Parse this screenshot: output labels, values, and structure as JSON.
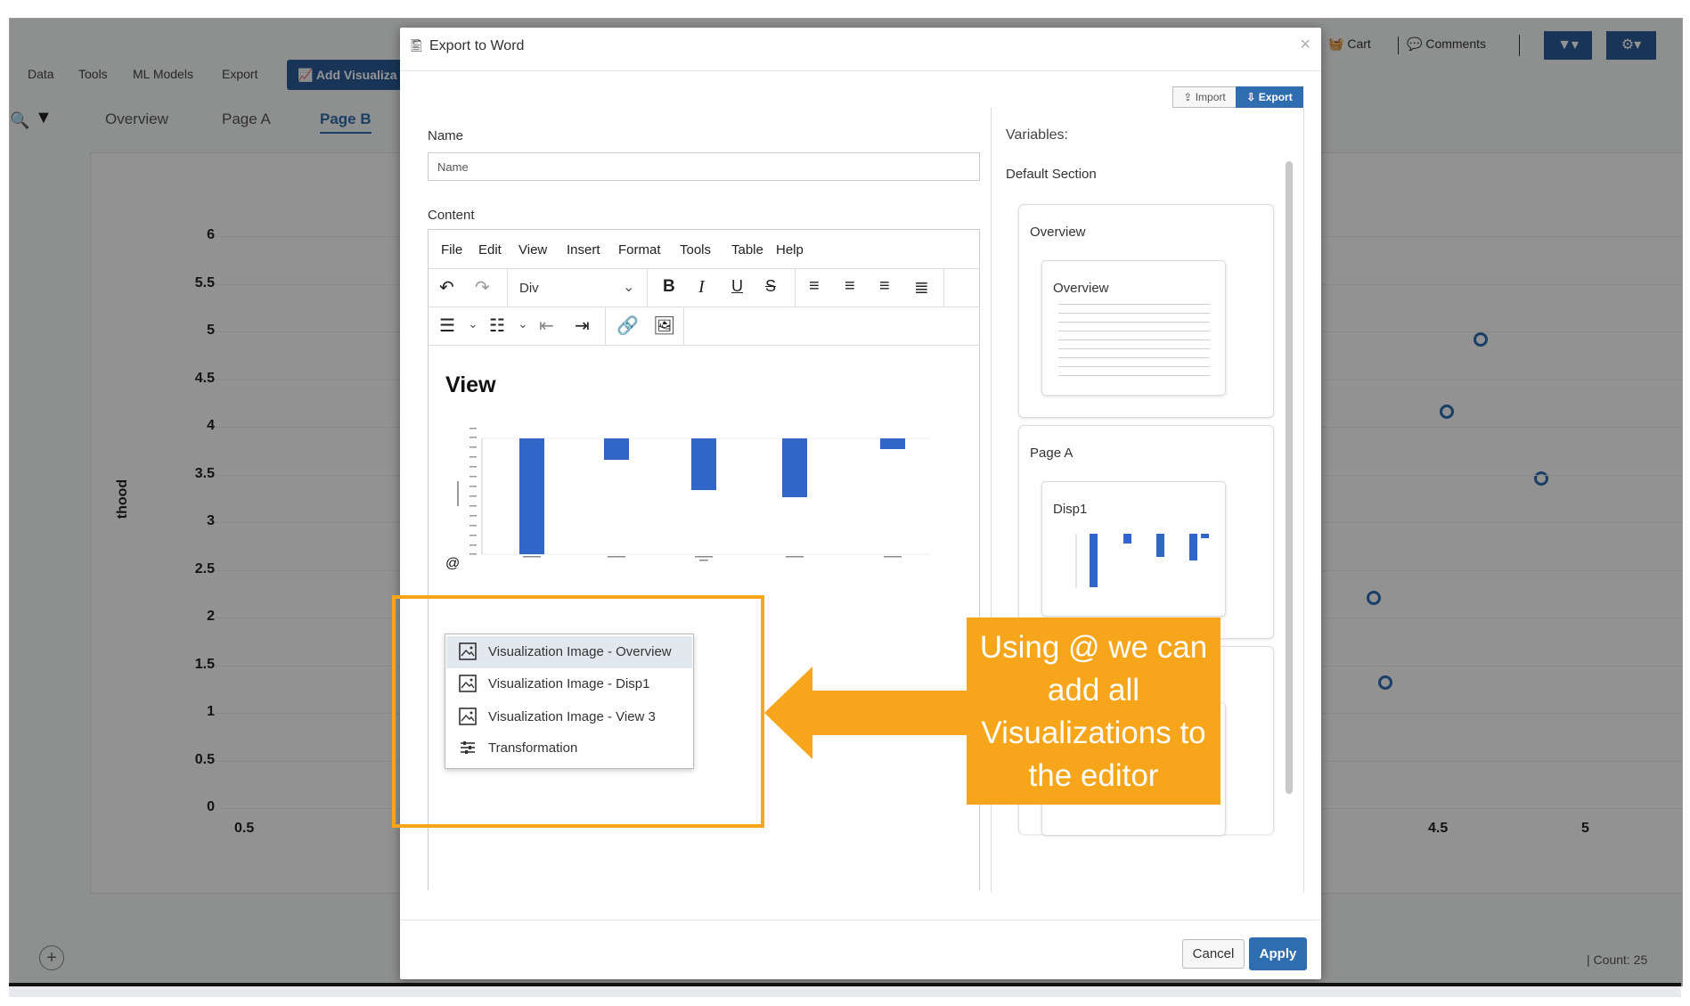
{
  "app": {
    "nav": [
      "Data",
      "Tools",
      "ML Models",
      "Export"
    ],
    "add_viz_label": "Add Visualiza",
    "tabs": [
      "Overview",
      "Page A",
      "Page B"
    ],
    "toolbar_right": {
      "cart": "Cart",
      "comments": "Comments"
    },
    "count_label": "Count: 25",
    "y_axis_label": "thood",
    "y_ticks": [
      "6",
      "5.5",
      "5",
      "4.5",
      "4",
      "3.5",
      "3",
      "2.5",
      "2",
      "1.5",
      "1",
      "0.5",
      "0"
    ],
    "x_ticks": [
      "0.5",
      "4.5",
      "5"
    ]
  },
  "modal": {
    "title": "Export to Word",
    "close": "×",
    "import_label": "Import",
    "export_label": "Export",
    "name_label": "Name",
    "name_placeholder": "Name",
    "content_label": "Content",
    "menu": [
      "File",
      "Edit",
      "View",
      "Insert",
      "Format",
      "Tools",
      "Table",
      "Help"
    ],
    "block_format": "Div",
    "editor_heading": "View",
    "at_symbol": "@",
    "dropdown": [
      "Visualization Image - Overview",
      "Visualization Image - Disp1",
      "Visualization Image - View 3",
      "Transformation"
    ],
    "variables_label": "Variables:",
    "default_section": "Default Section",
    "cards": [
      {
        "title": "Overview",
        "inner": "Overview"
      },
      {
        "title": "Page A",
        "inner": "Disp1"
      }
    ],
    "cancel_label": "Cancel",
    "apply_label": "Apply"
  },
  "callout": {
    "lines": [
      "Using @ we can",
      "add all",
      "Visualizations to",
      "the editor"
    ]
  },
  "colors": {
    "accent": "#2a5a94",
    "bar": "#3166c9",
    "callout": "#f7a51a"
  }
}
